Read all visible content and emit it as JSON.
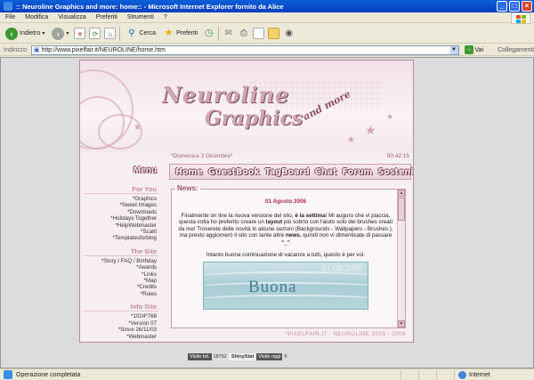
{
  "window": {
    "title": ":: Neuroline Graphics and more: home:: - Microsoft Internet Explorer fornito da Alice"
  },
  "menubar": {
    "items": [
      "File",
      "Modifica",
      "Visualizza",
      "Preferiti",
      "Strumenti",
      "?"
    ]
  },
  "toolbar": {
    "back_label": "Indietro",
    "search_label": "Cerca",
    "favorites_label": "Preferiti"
  },
  "addressbar": {
    "label": "Indirizzo",
    "url": "http://www.pixelfair.it/NEUROLINE/home.htm",
    "go_label": "Vai",
    "links_label": "Collegamenti"
  },
  "site": {
    "header": {
      "title_line1": "Neuroline",
      "title_line2": "Graphics",
      "title_line3": "and more"
    },
    "datebar": {
      "date": "*Domenica 3 Dicembre*",
      "time": "00:42:15"
    },
    "menu_head": "Menu",
    "nav": [
      "Home",
      "GuestBook",
      "TagBoard",
      "Chat",
      "Forum",
      "Sosteniamo"
    ],
    "sidebar": {
      "for_you_title": "For You",
      "for_you_items": [
        "*Graphics",
        "*Sweet Images",
        "*Downloads",
        "*Holidays Together",
        "*HelpWebmaster",
        "*Scatti",
        "*Templatesforblog"
      ],
      "the_site_title": "The Site",
      "the_site_items": [
        "*Story / FAQ / Birthday",
        "*Awards",
        "*Links",
        "*Map",
        "*Credits",
        "*Rules"
      ],
      "info_title": "Info Site",
      "info_items": [
        "*1024*768",
        "*Version 07",
        "*Since 26/11/03",
        "*Webmaster"
      ]
    },
    "news": {
      "title": "News:",
      "date": "01 Agosto 2006",
      "body_1": "Finalmente on line la nuova versione del sito, ",
      "body_1_bold": "è la settima",
      "body_2": "! Mi auguro che vi piaccia, questa volta ho preferito creare un ",
      "body_2_bold": "layout",
      "body_3": " più sobrio con l'aiuto solo dei brushes creati da me! Troverete delle novità in alcune sezioni (Backgrounds - Wallpapers - Brushes ), ma presto aggiornerò il sito con tante altre ",
      "body_3_bold": "news",
      "body_4": ", quindi non vi dimenticate di passare ^_^",
      "greeting": "Intanto buona continuazione di vacanze a tutti, questo è per voi:",
      "image_date": "01/08/2006",
      "image_word": "Buona"
    },
    "footer": "*PIXELFAIR.IT - NEUROLINE 2003 - 2006"
  },
  "counter": {
    "visits_label": "Visite tot.",
    "visits_value": "18752",
    "brand": "ShinyStat",
    "today_label": "Visite oggi",
    "today_value": "5"
  },
  "statusbar": {
    "text": "Operazione completata",
    "zone": "Internet"
  },
  "colors": {
    "ie_title_blue": "#0a3dbe",
    "site_pink": "#c78a9f",
    "news_date_red": "#b5264d"
  }
}
